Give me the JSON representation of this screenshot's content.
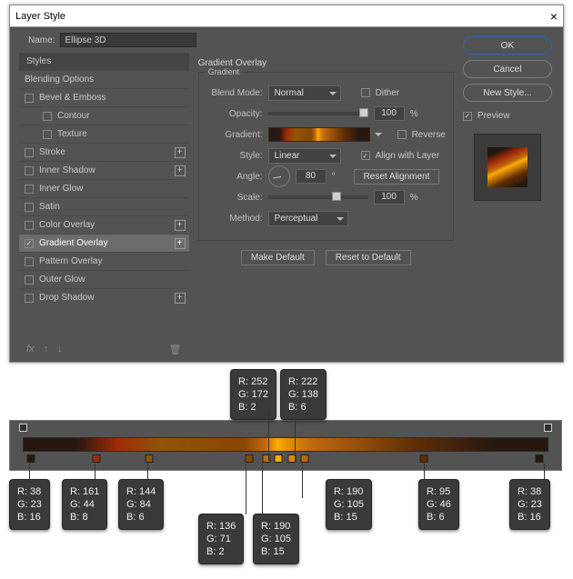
{
  "window": {
    "title": "Layer Style"
  },
  "name_row": {
    "label": "Name:",
    "value": "Ellipse 3D"
  },
  "buttons": {
    "ok": "OK",
    "cancel": "Cancel",
    "new_style": "New Style...",
    "preview_label": "Preview"
  },
  "styles": {
    "header": "Styles",
    "blending_options": "Blending Options",
    "items": [
      {
        "label": "Bevel & Emboss",
        "checked": false,
        "plus": false
      },
      {
        "label": "Contour",
        "checked": false,
        "sub": true
      },
      {
        "label": "Texture",
        "checked": false,
        "sub": true
      },
      {
        "label": "Stroke",
        "checked": false,
        "plus": true
      },
      {
        "label": "Inner Shadow",
        "checked": false,
        "plus": true
      },
      {
        "label": "Inner Glow",
        "checked": false
      },
      {
        "label": "Satin",
        "checked": false
      },
      {
        "label": "Color Overlay",
        "checked": false,
        "plus": true
      },
      {
        "label": "Gradient Overlay",
        "checked": true,
        "plus": true,
        "selected": true
      },
      {
        "label": "Pattern Overlay",
        "checked": false
      },
      {
        "label": "Outer Glow",
        "checked": false
      },
      {
        "label": "Drop Shadow",
        "checked": false,
        "plus": true
      }
    ],
    "fx_label": "fx"
  },
  "overlay": {
    "title": "Gradient Overlay",
    "legend": "Gradient",
    "blend_mode": {
      "label": "Blend Mode:",
      "value": "Normal"
    },
    "dither": {
      "label": "Dither",
      "checked": false
    },
    "opacity": {
      "label": "Opacity:",
      "value": "100",
      "suffix": "%"
    },
    "gradient": {
      "label": "Gradient:"
    },
    "reverse": {
      "label": "Reverse",
      "checked": false
    },
    "align": {
      "label": "Align with Layer",
      "checked": true
    },
    "style": {
      "label": "Style:",
      "value": "Linear"
    },
    "angle": {
      "label": "Angle:",
      "value": "80",
      "suffix": "°",
      "reset": "Reset Alignment"
    },
    "scale": {
      "label": "Scale:",
      "value": "100",
      "suffix": "%"
    },
    "method": {
      "label": "Method:",
      "value": "Perceptual"
    },
    "make_default": "Make Default",
    "reset_default": "Reset to Default"
  },
  "gradient_stops": [
    {
      "pos": 1.5,
      "r": 38,
      "g": 23,
      "b": 16
    },
    {
      "pos": 14,
      "r": 161,
      "g": 44,
      "b": 8
    },
    {
      "pos": 24,
      "r": 144,
      "g": 84,
      "b": 6
    },
    {
      "pos": 43,
      "r": 136,
      "g": 71,
      "b": 2
    },
    {
      "pos": 46.2,
      "r": 190,
      "g": 105,
      "b": 15
    },
    {
      "pos": 48.5,
      "r": 252,
      "g": 172,
      "b": 2
    },
    {
      "pos": 51,
      "r": 222,
      "g": 138,
      "b": 6
    },
    {
      "pos": 53.5,
      "r": 190,
      "g": 105,
      "b": 15
    },
    {
      "pos": 76,
      "r": 95,
      "g": 46,
      "b": 6
    },
    {
      "pos": 98,
      "r": 38,
      "g": 23,
      "b": 16
    }
  ],
  "callouts": {
    "top": [
      "R: 252\nG: 172\nB: 2",
      "R: 222\nG: 138\nB: 6"
    ],
    "bottom": [
      "R: 38\nG: 23\nB: 16",
      "R: 161\nG: 44\nB: 8",
      "R: 144\nG: 84\nB: 6",
      "R: 136\nG: 71\nB: 2",
      "R: 190\nG: 105\nB: 15",
      "R: 190\nG: 105\nB: 15",
      "R: 95\nG: 46\nB: 6",
      "R: 38\nG: 23\nB: 16"
    ]
  }
}
